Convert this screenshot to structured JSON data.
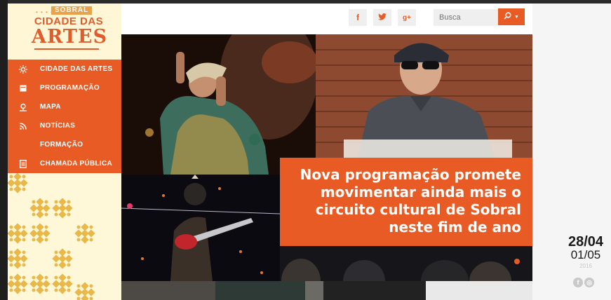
{
  "logo": {
    "badge": "SOBRAL",
    "line1": "CIDADE DAS",
    "line2": "ARTES"
  },
  "menu": {
    "items": [
      {
        "label": "CIDADE DAS ARTES",
        "icon": "sun-icon"
      },
      {
        "label": "PROGRAMAÇÃO",
        "icon": "calendar-icon"
      },
      {
        "label": "MAPA",
        "icon": "map-pin-icon"
      },
      {
        "label": "NOTÍCIAS",
        "icon": "rss-icon"
      },
      {
        "label": "FORMAÇÃO",
        "icon": ""
      },
      {
        "label": "CHAMADA PÚBLICA",
        "icon": "document-icon"
      }
    ]
  },
  "header": {
    "social": [
      {
        "glyph": "f",
        "name": "facebook-icon"
      },
      {
        "glyph": "t",
        "name": "twitter-icon"
      },
      {
        "glyph": "g+",
        "name": "google-plus-icon"
      }
    ],
    "search_placeholder": "Busca"
  },
  "hero": {
    "caption": "Nova programação promete movimentar ainda mais o circuito cultural de Sobral neste fim de ano"
  },
  "event": {
    "date_start": "28/04",
    "date_end": "01/05",
    "year": "2016"
  },
  "colors": {
    "accent": "#e95b25",
    "sidebar_bg": "#fdf6d4",
    "pattern_gold": "#e8b94a"
  }
}
